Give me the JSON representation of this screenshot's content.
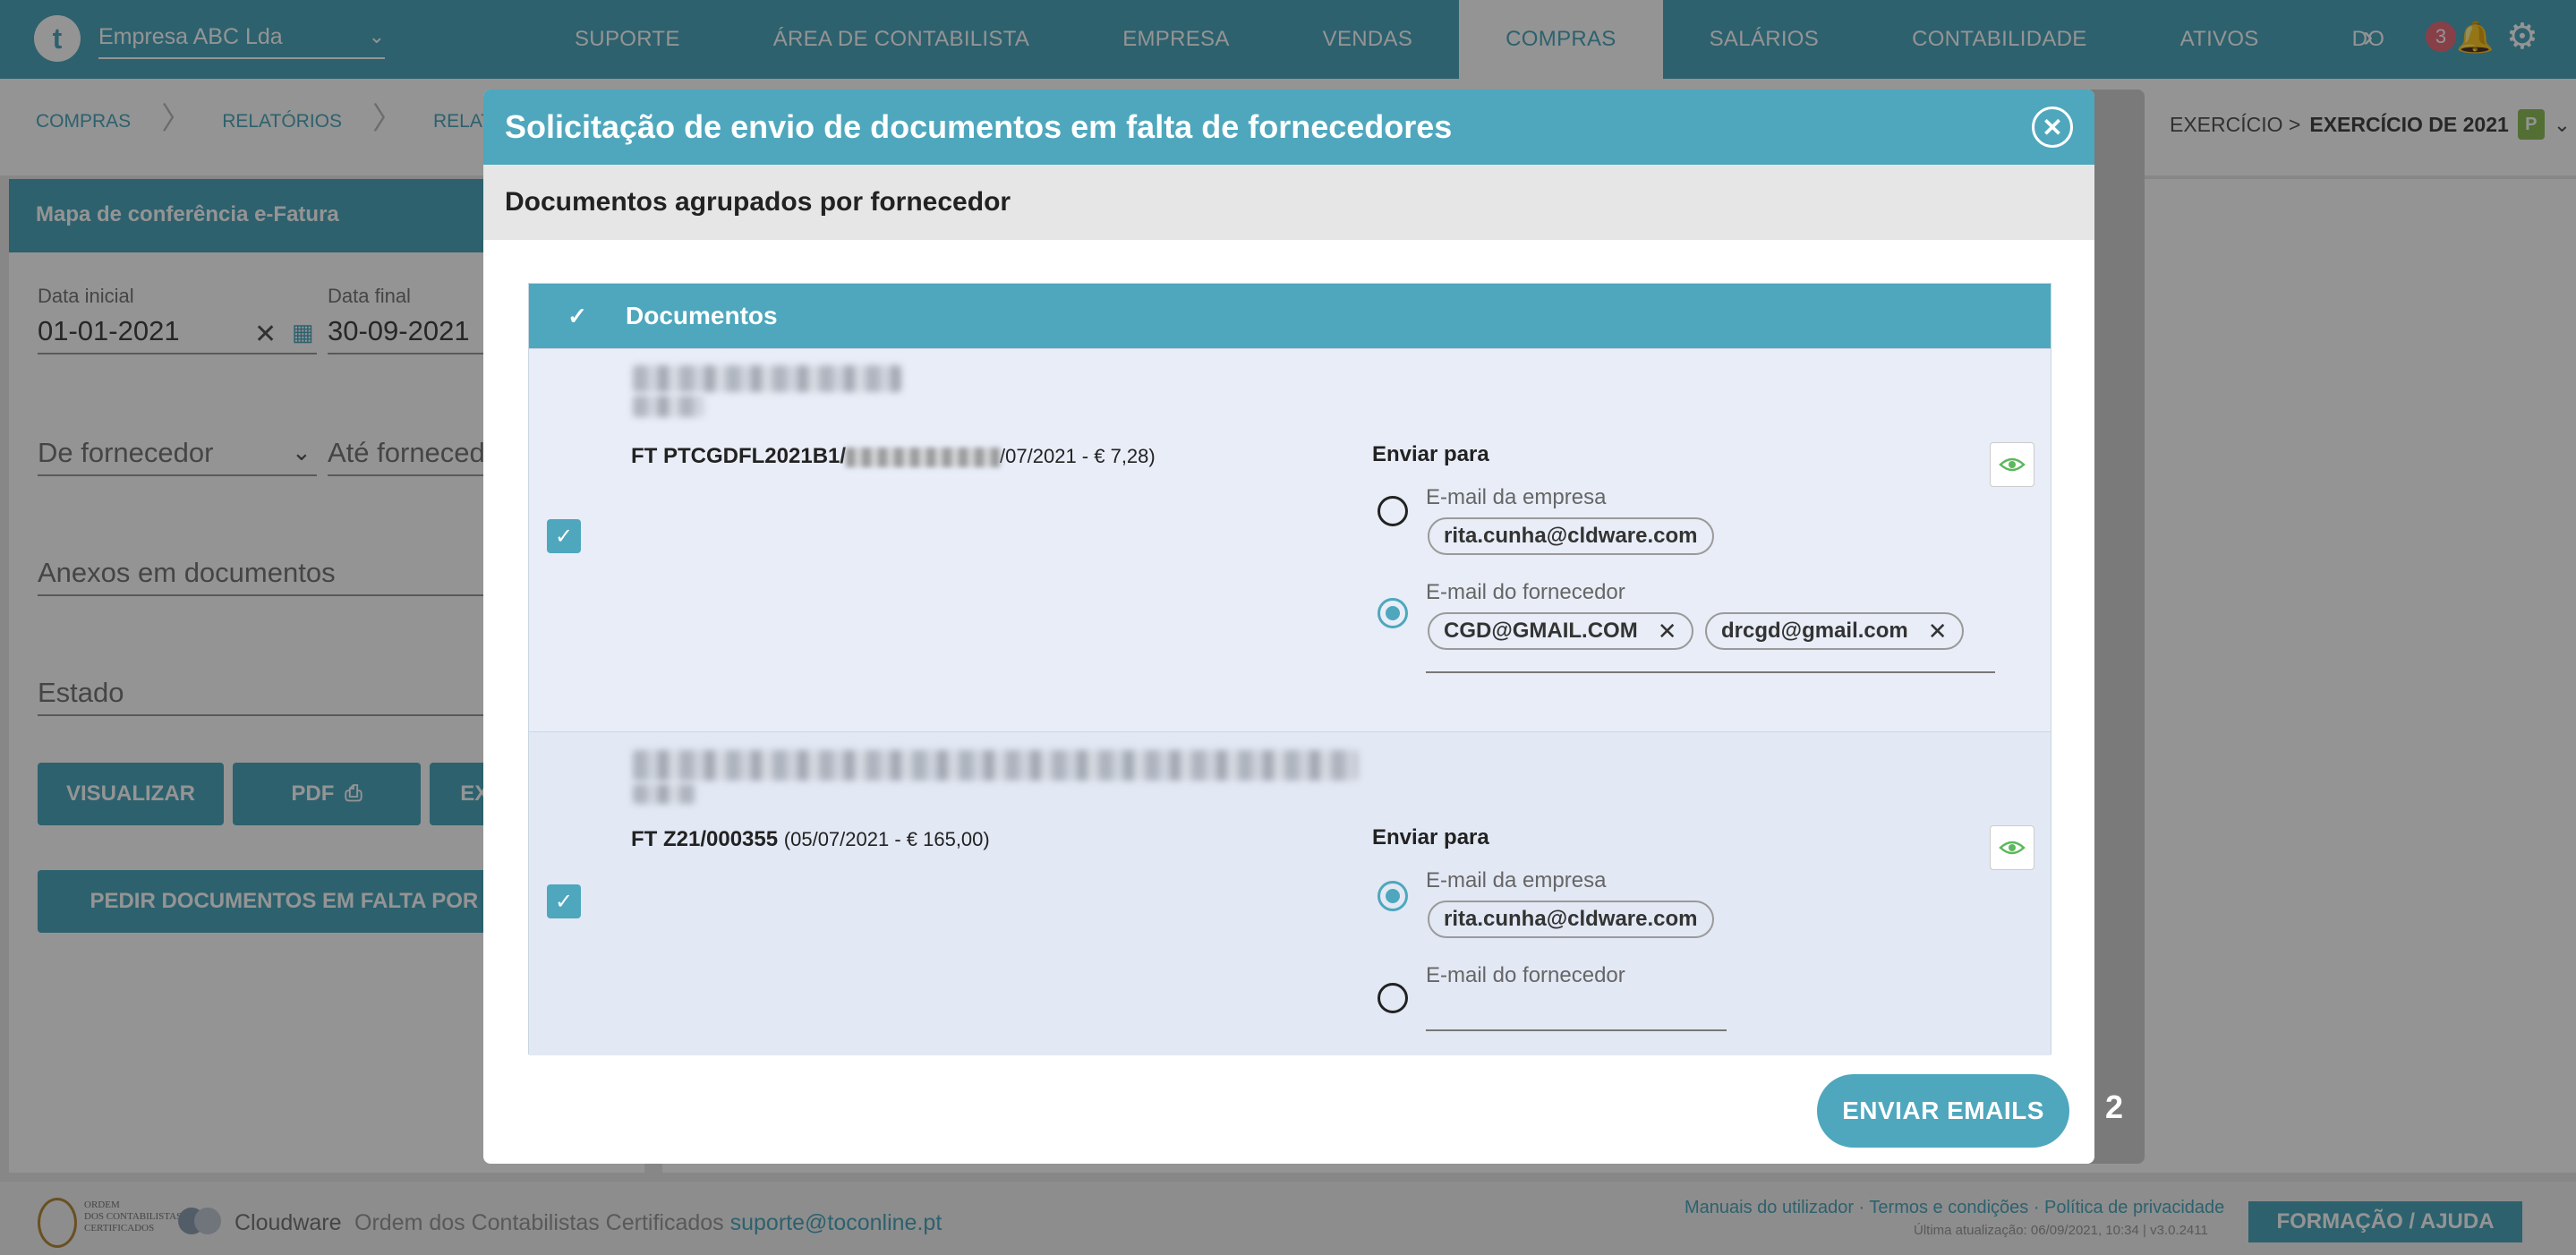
{
  "topbar": {
    "logo": "t",
    "company": "Empresa ABC Lda",
    "nav": [
      "SUPORTE",
      "ÁREA DE CONTABILISTA",
      "EMPRESA",
      "VENDAS",
      "COMPRAS",
      "SALÁRIOS",
      "CONTABILIDADE",
      "ATIVOS",
      "DO"
    ],
    "active_nav": "COMPRAS",
    "notification_count": "3",
    "colors": {
      "primary": "#4ea7bd",
      "badge": "#e86f7d"
    }
  },
  "breadcrumb": [
    "COMPRAS",
    "RELATÓRIOS",
    "RELATÓRIOS"
  ],
  "exercise": {
    "prefix": "EXERCÍCIO >",
    "value": "EXERCÍCIO DE 2021",
    "badge": "P"
  },
  "left_panel": {
    "title": "Mapa de conferência e-Fatura",
    "start_label": "Data inicial",
    "start_value": "01-01-2021",
    "end_label": "Data final",
    "end_value": "30-09-2021",
    "supplier_from": "De fornecedor",
    "supplier_to": "Até fornecedor",
    "attachments": "Anexos em documentos",
    "state": "Estado",
    "btn_view": "VISUALIZAR",
    "btn_pdf": "PDF",
    "btn_export": "EXPORTAR",
    "btn_request": "PEDIR DOCUMENTOS EM FALTA POR E-MAIL"
  },
  "behind_number": "2",
  "modal": {
    "title": "Solicitação de envio de documentos em falta de fornecedores",
    "subtitle": "Documentos agrupados por fornecedor",
    "column": "Documentos",
    "send_button": "ENVIAR EMAILS",
    "rows": [
      {
        "doc_prefix": "FT PTCGDFL2021B1/",
        "doc_suffix": "/07/2021 - € 7,28)",
        "send_to": "Enviar para",
        "company_email_label": "E-mail da empresa",
        "company_email": "rita.cunha@cldware.com",
        "supplier_email_label": "E-mail do fornecedor",
        "supplier_emails": [
          "CGD@GMAIL.COM",
          "drcgd@gmail.com"
        ]
      },
      {
        "doc": "FT Z21/000355",
        "doc_detail": "(05/07/2021 - € 165,00)",
        "send_to": "Enviar para",
        "company_email_label": "E-mail da empresa",
        "company_email": "rita.cunha@cldware.com",
        "supplier_email_label": "E-mail do fornecedor"
      }
    ]
  },
  "footer": {
    "ordem": "Ordem dos Contabilistas Certificados",
    "seal_caption": [
      "ORDEM",
      "DOS CONTABILISTAS",
      "CERTIFICADOS"
    ],
    "cloudware": "Cloudware",
    "org_text": "Ordem dos Contabilistas Certificados",
    "email": "suporte@toconline.pt",
    "links": "Manuais do utilizador · Termos e condições · Política de privacidade",
    "updated": "Última atualização: 06/09/2021, 10:34 | v3.0.2411",
    "help": "FORMAÇÃO / AJUDA"
  }
}
